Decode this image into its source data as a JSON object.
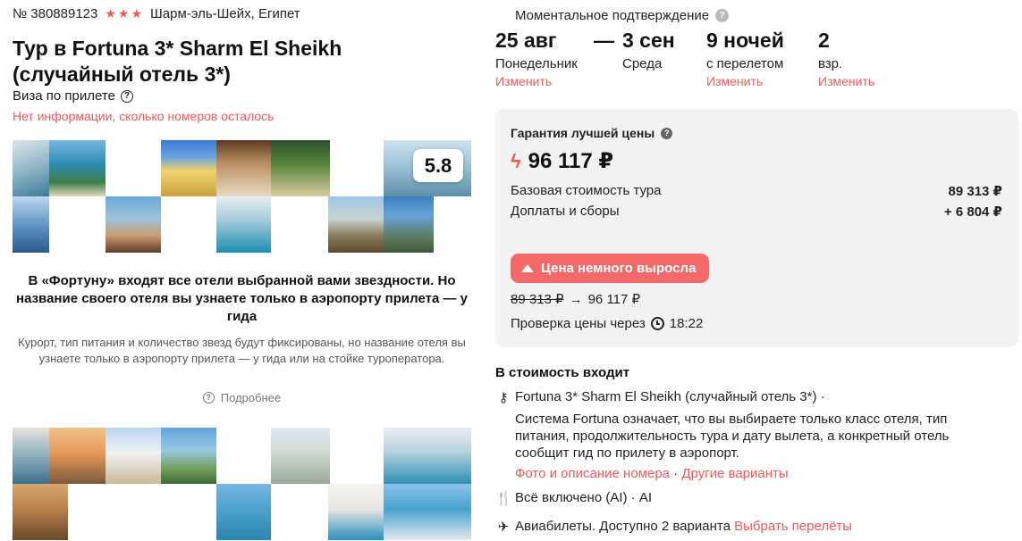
{
  "header": {
    "tour_number": "№ 380889123",
    "stars": [
      "star",
      "star",
      "star"
    ],
    "location": "Шарм-эль-Шейх, Египет",
    "title": "Тур в Fortuna 3* Sharm El Sheikh (случайный отель 3*)",
    "visa": "Виза по прилете",
    "rooms_info": "Нет информации, сколько номеров осталось"
  },
  "gallery": {
    "rating": "5.8"
  },
  "fortuna": {
    "headline": "В «Фортуну» входят все отели выбранной вами звездности. Но название своего отеля вы узнаете только в аэропорту прилета — у гида",
    "description": "Курорт, тип питания и количество звезд будут фиксированы, но название отеля вы узнаете только в аэропорту прилета — у гида или на стойке туроператора.",
    "more_label": "Подробнее"
  },
  "booking": {
    "instant_confirmation": "Моментальное подтверждение",
    "dash": "—",
    "date_from": {
      "value": "25 авг",
      "weekday": "Понедельник",
      "change": "Изменить"
    },
    "date_to": {
      "value": "3 сен",
      "weekday": "Среда"
    },
    "nights": {
      "value": "9 ночей",
      "note": "с перелетом",
      "change": "Изменить"
    },
    "adults": {
      "value": "2",
      "note": "взр.",
      "change": "Изменить"
    }
  },
  "price": {
    "guarantee_label": "Гарантия лучшей цены",
    "total": "96 117 ₽",
    "base_label": "Базовая стоимость тура",
    "base_value": "89 313 ₽",
    "extra_label": "Доплаты и сборы",
    "extra_value": "+ 6 804 ₽",
    "alert": "Цена немного выросла",
    "old_price": "89 313 ₽",
    "arrow": "→",
    "new_price": "96 117 ₽",
    "check_label": "Проверка цены через",
    "check_time": "18:22"
  },
  "includes": {
    "title": "В стоимость входит",
    "hotel": "Fortuna 3* Sharm El Sheikh (случайный отель 3*) ·",
    "hotel_desc": "Система Fortuna означает, что вы выбираете только класс отеля, тип питания, продолжительность тура и дату вылета, а конкретный отель сообщит гид по прилету в аэропорт.",
    "room_link": "Фото и описание номера",
    "link_sep": " · ",
    "other_link": "Другие варианты",
    "meal": "Всё включено (AI) · AI",
    "flights": "Авиабилеты. Доступно 2 варианта",
    "flights_link": "Выбрать перелёты"
  },
  "colors": {
    "accent": "#f05a5a",
    "alert_bg": "#f46a6a",
    "card_bg": "#f2f2f2"
  },
  "icons": {
    "stars": "star-icon",
    "visa_help": "question-circle-icon",
    "price_bolt": "lightning-icon",
    "price_up": "triangle-up-icon",
    "timer": "clock-icon",
    "hotel": "key-icon",
    "meal": "fork-knife-icon",
    "flight": "airplane-icon"
  }
}
